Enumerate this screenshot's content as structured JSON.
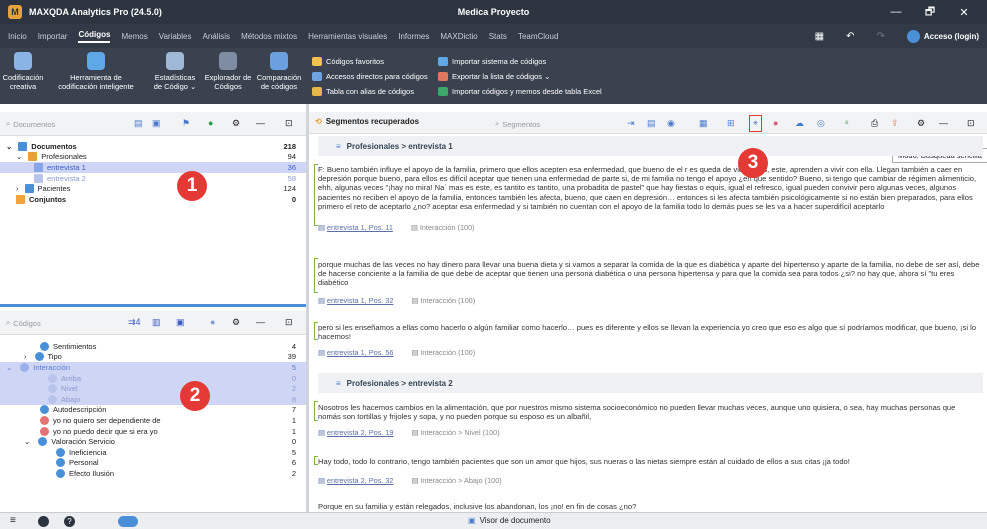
{
  "app": {
    "title": "MAXQDA Analytics Pro (24.5.0)",
    "document": "Medica Proyecto",
    "win": [
      "—",
      "🗗",
      "✕"
    ]
  },
  "menu": {
    "items": [
      "Inicio",
      "Importar",
      "Códigos",
      "Memos",
      "Variables",
      "Análisis",
      "Métodos mixtos",
      "Herramientas visuales",
      "Informes",
      "MAXDictio",
      "Stats",
      "TeamCloud"
    ],
    "login": "Acceso (login)"
  },
  "ribbon": {
    "b1": "Codificación creativa",
    "b2": "Herramienta de codificación inteligente",
    "b3": "Estadísticas de Código ⌄",
    "b4": "Explorador de Códigos",
    "b5": "Comparación de códigos",
    "l1": "Códigos favoritos",
    "l2": "Accesos directos para códigos",
    "l3": "Tabla con alias de códigos",
    "l4": "Importar sistema de códigos",
    "l5": "Exportar la lista de códigos ⌄",
    "l6": "Importar códigos y memos desde tabla Excel"
  },
  "docs": {
    "search": "Documentos",
    "items": [
      {
        "label": "Documentos",
        "count": "218"
      },
      {
        "label": "Profesionales",
        "count": "94"
      },
      {
        "label": "entrevista 1",
        "count": "36"
      },
      {
        "label": "entrevista 2",
        "count": "58"
      },
      {
        "label": "Pacientes",
        "count": "124"
      },
      {
        "label": "Conjuntos",
        "count": "0"
      }
    ]
  },
  "codes": {
    "search": "Códigos",
    "badge": "4",
    "items": [
      {
        "label": "Sentimientos",
        "count": "4"
      },
      {
        "label": "Tipo",
        "count": "39"
      },
      {
        "label": "Interacción",
        "count": "5"
      },
      {
        "label": "Arriba",
        "count": "0"
      },
      {
        "label": "Nivel",
        "count": "2"
      },
      {
        "label": "Abajo",
        "count": "8"
      },
      {
        "label": "Autodescripción",
        "count": "7"
      },
      {
        "label": "yo no quiero ser dependiente de",
        "count": "1"
      },
      {
        "label": "yo no puedo decir que si era yo",
        "count": "1"
      },
      {
        "label": "Valoración Servicio",
        "count": "0"
      },
      {
        "label": "Ineficiencia",
        "count": "5"
      },
      {
        "label": "Personal",
        "count": "6"
      },
      {
        "label": "Efecto Ilusión",
        "count": "2"
      }
    ]
  },
  "segments": {
    "title": "Segmentos recuperados",
    "search": "Segmentos",
    "mode": "Modo: Búsqueda sencilla",
    "group1": "Profesionales > entrevista 1",
    "group2": "Profesionales > entrevista 2",
    "items": [
      {
        "text": "F: Bueno también influye el apoyo de la familia, primero que ellos acepten esa enfermedad, que bueno de el r  es queda de vida, ellos, este, aprenden a vivir con ella. Llegan también a caer en depresión porque bueno, para ellos es difícil aceptar que tienen una enfermedad de         parte si, de mi familia no tengo el apoyo ¿en que sentido? Bueno, si tengo que cambiar de régimen alimenticio, ehh, algunas veces \"¡hay no mira! Na´ mas es este, es tantito es tantito, una probadita de pastel\" que hay fiestas o equis, igual el refresco, igual pueden convivir pero algunas veces, algunos pacientes no reciben el apoyo de la familia, entonces también les afecta, bueno, que caen en depresión… entonces si les afecta también psicológicamente si no están bien preparados, para ellos primero el reto de aceptarlo ¿no? aceptar esa enfermedad y si también no cuentan con el apoyo de la familia todo lo demás pues se les va a hacer superdifícil aceptarlo",
        "src": "entrevista 1, Pos. 11",
        "code": "Interacción (100)"
      },
      {
        "text": "porque muchas de las veces no hay dinero para llevar una buena dieta y si vamos a separar la comida de la que es diabética y aparte del hipertenso y aparte de la familia, no debe de ser así, debe de hacerse conciente a la familia de que debe de aceptar que tienen una persona diabética o una persona hipertensa y para que la comida sea para todos ¿si? no hay que, ahora sí \"tu eres diabético",
        "src": "entrevista 1, Pos. 32",
        "code": "Interacción (100)"
      },
      {
        "text": "pero si les enseñamos a ellas como hacerlo o algún familiar como hacerlo… pues es diferente y ellos se llevan la experiencia yo creo que eso es algo que sí podríamos modificar, que bueno, ¡si lo hacemos!",
        "src": "entrevista 1, Pos. 56",
        "code": "Interacción (100)"
      },
      {
        "text": "Nosotros les hacemos cambios en la alimentación, que por nuestros mismo sistema socioeconómico no pueden llevar muchas veces, aunque uno quisiera, o sea, hay muchas personas que nomás son tortillas y frijoles y sopa, y no pueden porque su esposo es un albañil,",
        "src": "entrevista 2, Pos. 19",
        "code": "Interacción > Nivel (100)"
      },
      {
        "text": "Hay todo, todo lo contrario, tengo también pacientes que son un amor que hijos, sus nueras o las nietas siempre están al cuidado de ellos a sus citas ¡ja todo!",
        "src": "entrevista 2, Pos. 32",
        "code": "Interacción > Abajo (100)"
      },
      {
        "text": "Porque en su familia y están relegados, inclusive los abandonan, los ¡no! en fin de cosas ¿no?",
        "src": "",
        "code": ""
      }
    ]
  },
  "annotations": [
    "1",
    "2",
    "3"
  ],
  "status": {
    "viewer": "Visor de documento"
  }
}
